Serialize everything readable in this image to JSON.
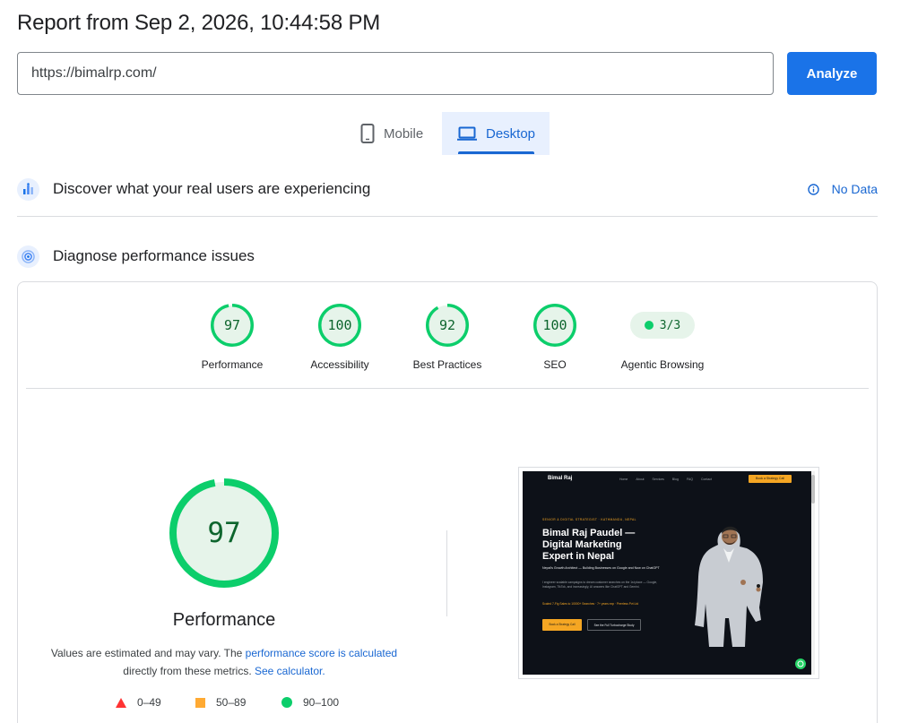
{
  "report": {
    "title": "Report from Sep 2, 2026, 10:44:58 PM"
  },
  "url_input": {
    "value": "https://bimalrp.com/"
  },
  "analyze_button": {
    "label": "Analyze"
  },
  "device_tabs": {
    "mobile": {
      "label": "Mobile",
      "icon": "smartphone-icon"
    },
    "desktop": {
      "label": "Desktop",
      "icon": "laptop-icon",
      "selected": true
    }
  },
  "field_data": {
    "title": "Discover what your real users are experiencing",
    "status": "No Data",
    "icon": "users-chart-icon",
    "status_icon": "info-icon"
  },
  "lab_data": {
    "title": "Diagnose performance issues",
    "icon": "performance-icon"
  },
  "categories": [
    {
      "label": "Performance",
      "score": "97",
      "fraction": 0.97
    },
    {
      "label": "Accessibility",
      "score": "100",
      "fraction": 1.0
    },
    {
      "label": "Best Practices",
      "score": "92",
      "fraction": 0.92
    },
    {
      "label": "SEO",
      "score": "100",
      "fraction": 1.0
    }
  ],
  "agentic": {
    "label": "Agentic Browsing",
    "value": "3/3"
  },
  "performance": {
    "score": "97",
    "fraction": 0.97,
    "title": "Performance",
    "note_prefix": "Values are estimated and may vary. The ",
    "note_link1": "performance score is calculated",
    "note_mid": "directly from these metrics. ",
    "note_link2": "See calculator."
  },
  "legend": [
    {
      "range": "0–49",
      "shape": "triangle",
      "color": "#ff3333"
    },
    {
      "range": "50–89",
      "shape": "square",
      "color": "#ffaa33"
    },
    {
      "range": "90–100",
      "shape": "circle",
      "color": "#0cce6b"
    }
  ],
  "colors": {
    "pass": "#0cce6b",
    "pass_bg": "#e6f4ea",
    "accent": "#1a73e8"
  },
  "screenshot": {
    "brand": "Bimal Raj",
    "nav": [
      "Home",
      "About",
      "Services",
      "Blog",
      "FAQ",
      "Contact"
    ],
    "cta": "Book a Strategy Call",
    "eyebrow": "SENIOR & DIGITAL STRATEGIST · KATHMANDU, NEPAL",
    "headline_1": "Bimal Raj Paudel —",
    "headline_2": "Digital Marketing",
    "headline_3": "Expert in Nepal",
    "subhead": "Nepal's Growth Architect — Building Businesses on Google and Now on ChatGPT",
    "body": "I engineer scalable campaigns to dream customer searches on the 1st place — Google, Instagram, TikTok, and increasingly, AI answers like ChatGPT and Gemini.",
    "highlight": "Scaled 7-Fig Sales to 10000+ Searches · 7+ years exp · Peerless Pvt Ltd",
    "btn1": "Book a Strategy Call",
    "btn2": "See the Full Turbocharge Study"
  }
}
